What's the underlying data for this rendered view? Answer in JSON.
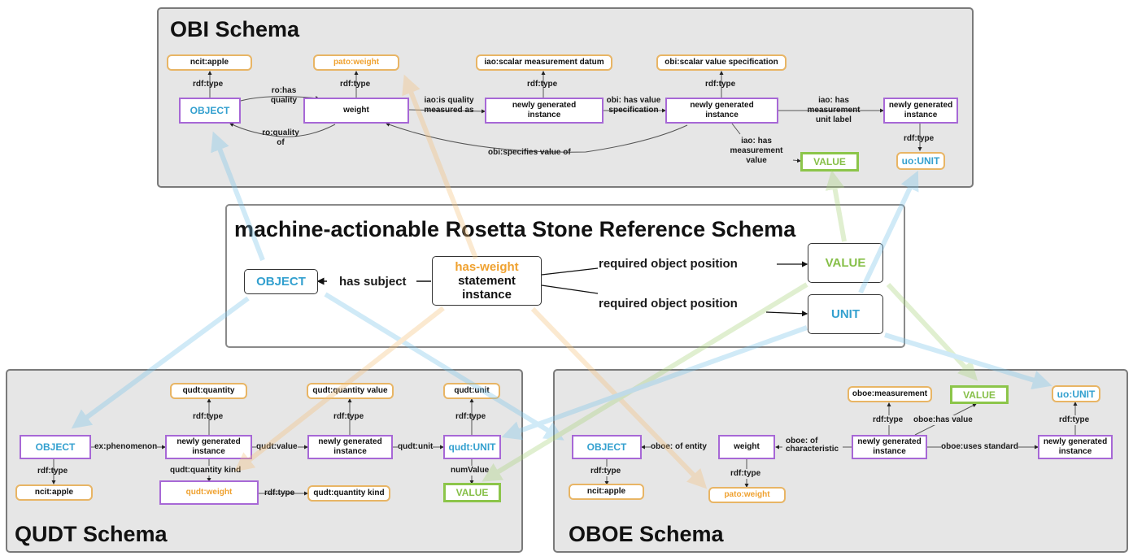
{
  "colors": {
    "instance_border": "#a768d6",
    "class_border": "#e8b565",
    "value_border": "#8cc54a",
    "object_text": "#33a0cf",
    "weight_text": "#efa12f",
    "value_text": "#86bf48",
    "panel_bg": "#e6e6e6"
  },
  "obi": {
    "title": "OBI Schema",
    "nodes": {
      "ncit_apple": "ncit:apple",
      "pato_weight": "pato:weight",
      "iao_datum": "iao:scalar measurement datum",
      "obi_spec": "obi:scalar value specification",
      "object": "OBJECT",
      "weight": "weight",
      "inst1": "newly generated instance",
      "inst2": "newly generated instance",
      "inst3": "newly generated instance",
      "value": "VALUE",
      "uo_unit": "uo:UNIT"
    },
    "edges": {
      "rdf_type_1": "rdf:type",
      "rdf_type_2": "rdf:type",
      "rdf_type_3": "rdf:type",
      "rdf_type_4": "rdf:type",
      "rdf_type_5": "rdf:type",
      "has_quality": "ro:has quality",
      "quality_of": "ro:quality of",
      "is_quality_measured_as": "iao:is quality measured as",
      "has_value_spec": "obi: has value specification",
      "has_unit_label": "iao: has measurement unit label",
      "has_measurement_value": "iao: has measurement value",
      "specifies_value_of": "obi:specifies value of"
    }
  },
  "reference": {
    "title": "machine-actionable Rosetta Stone Reference Schema",
    "nodes": {
      "object": "OBJECT",
      "statement_highlight": "has-weight",
      "statement_rest": "statement instance",
      "value": "VALUE",
      "unit": "UNIT"
    },
    "edges": {
      "has_subject": "has subject",
      "req_pos_1": "required object position",
      "req_pos_2": "required object position"
    }
  },
  "qudt": {
    "title": "QUDT Schema",
    "nodes": {
      "quantity": "qudt:quantity",
      "quantity_value": "qudt:quantity value",
      "unit_class": "qudt:unit",
      "object": "OBJECT",
      "inst1": "newly generated instance",
      "inst2": "newly generated instance",
      "unit": "qudt:UNIT",
      "ncit_apple": "ncit:apple",
      "weight": "qudt:weight",
      "quantity_kind_class": "qudt:quantity kind",
      "value": "VALUE"
    },
    "edges": {
      "rdf_type_1": "rdf:type",
      "rdf_type_2": "rdf:type",
      "rdf_type_3": "rdf:type",
      "rdf_type_4": "rdf:type",
      "rdf_type_5": "rdf:type",
      "phenomenon": "ex:phenomenon",
      "value": "qudt:value",
      "unit": "qudt:unit",
      "quantity_kind": "qudt:quantity kind",
      "num_value": "numValue"
    }
  },
  "oboe": {
    "title": "OBOE Schema",
    "nodes": {
      "measurement": "oboe:measurement",
      "value": "VALUE",
      "uo_unit": "uo:UNIT",
      "object": "OBJECT",
      "weight": "weight",
      "inst1": "newly generated instance",
      "inst2": "newly generated instance",
      "ncit_apple": "ncit:apple",
      "pato_weight": "pato:weight"
    },
    "edges": {
      "rdf_type_1": "rdf:type",
      "rdf_type_2": "rdf:type",
      "rdf_type_3": "rdf:type",
      "rdf_type_4": "rdf:type",
      "of_entity": "oboe: of entity",
      "of_characteristic": "oboe: of characteristic",
      "has_value": "oboe:has value",
      "uses_standard": "oboe:uses standard"
    }
  }
}
